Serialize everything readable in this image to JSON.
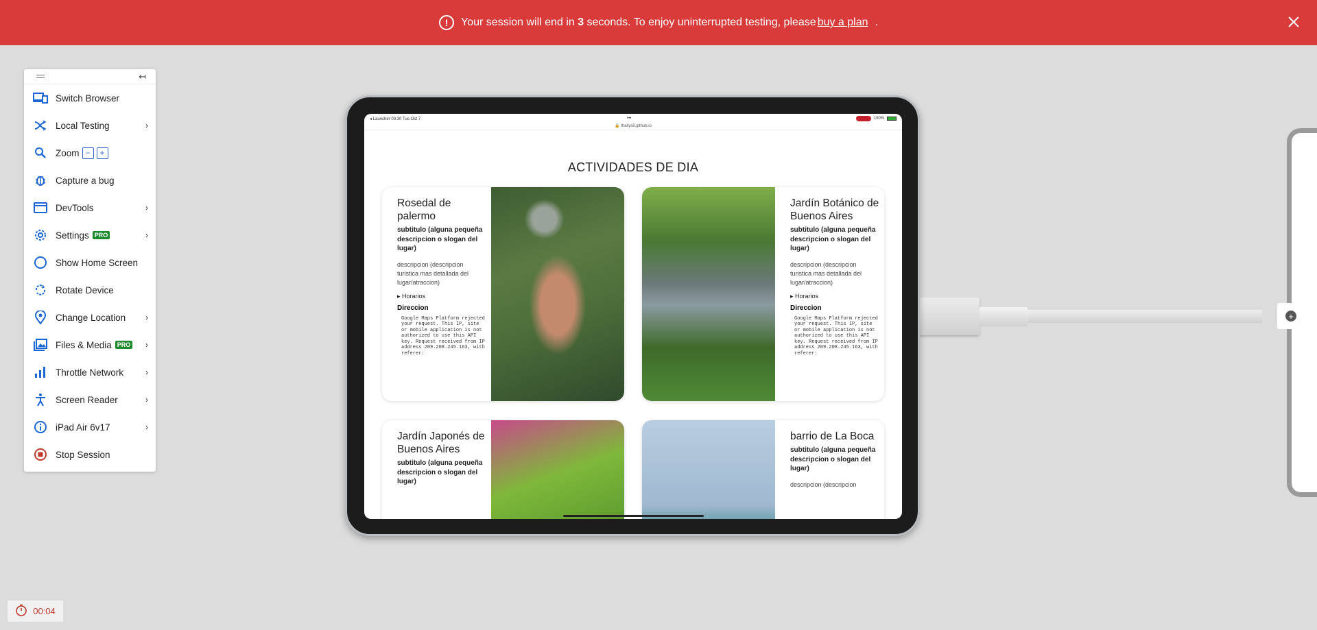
{
  "banner": {
    "text_before": "Your session will end in ",
    "seconds": "3",
    "text_after": " seconds. To enjoy uninterrupted testing, please ",
    "link": "buy a plan",
    "period": "."
  },
  "menu": {
    "items": [
      {
        "label": "Switch Browser",
        "icon": "switch-browser-icon"
      },
      {
        "label": "Local Testing",
        "icon": "local-testing-icon"
      },
      {
        "label": "Zoom",
        "icon": "zoom-icon"
      },
      {
        "label": "Capture a bug",
        "icon": "bug-icon"
      },
      {
        "label": "DevTools",
        "icon": "devtools-icon"
      },
      {
        "label": "Settings",
        "icon": "gear-icon",
        "badge": "PRO"
      },
      {
        "label": "Show Home Screen",
        "icon": "home-circle-icon"
      },
      {
        "label": "Rotate Device",
        "icon": "rotate-icon"
      },
      {
        "label": "Change Location",
        "icon": "location-pin-icon"
      },
      {
        "label": "Files & Media",
        "icon": "image-icon",
        "badge": "PRO"
      },
      {
        "label": "Throttle Network",
        "icon": "signal-bars-icon"
      },
      {
        "label": "Screen Reader",
        "icon": "accessibility-icon"
      },
      {
        "label": "iPad Air 6v17",
        "icon": "info-icon"
      },
      {
        "label": "Stop Session",
        "icon": "stop-icon"
      }
    ],
    "zoom_minus": "−",
    "zoom_plus": "+"
  },
  "timer": {
    "value": "00:04"
  },
  "device": {
    "status_left": "◂ Launcher   00:30   Tue Oct 7",
    "status_dots": "•••",
    "status_right": "100%",
    "url": "🔒 thallys8.github.io",
    "page_title": "ACTIVIDADES DE DIA",
    "cards": [
      {
        "title": "Rosedal de palermo",
        "subtitle": "subtitulo (alguna pequeña descripcion o slogan del lugar)",
        "description": "descripcion (descripcion turistica mas detallada del lugar/atraccion)",
        "horarios": "▸ Horarios",
        "direccion": "Direccion",
        "error": "Google Maps Platform rejected your request. This IP, site or mobile application is not authorized to use this API key. Request received from IP address 209.208.245.163, with referer:"
      },
      {
        "title": "Jardín Botánico de Buenos Aires",
        "subtitle": "subtitulo (alguna pequeña descripcion o slogan del lugar)",
        "description": "descripcion (descripcion turistica mas detallada del lugar/atraccion)",
        "horarios": "▸ Horarios",
        "direccion": "Direccion",
        "error": "Google Maps Platform rejected your request. This IP, site or mobile application is not authorized to use this API key. Request received from IP address 209.208.245.163, with referer:"
      },
      {
        "title": "Jardín Japonés de Buenos Aires",
        "subtitle": "subtitulo (alguna pequeña descripcion o slogan del lugar)"
      },
      {
        "title": "barrio de La Boca",
        "subtitle": "subtitulo (alguna pequeña descripcion o slogan del lugar)",
        "description": "descripcion (descripcion"
      }
    ]
  },
  "colors": {
    "banner": "#d93a3a",
    "accent": "#1a66d6",
    "pro": "#1e8a2e",
    "stop": "#c0392b"
  }
}
